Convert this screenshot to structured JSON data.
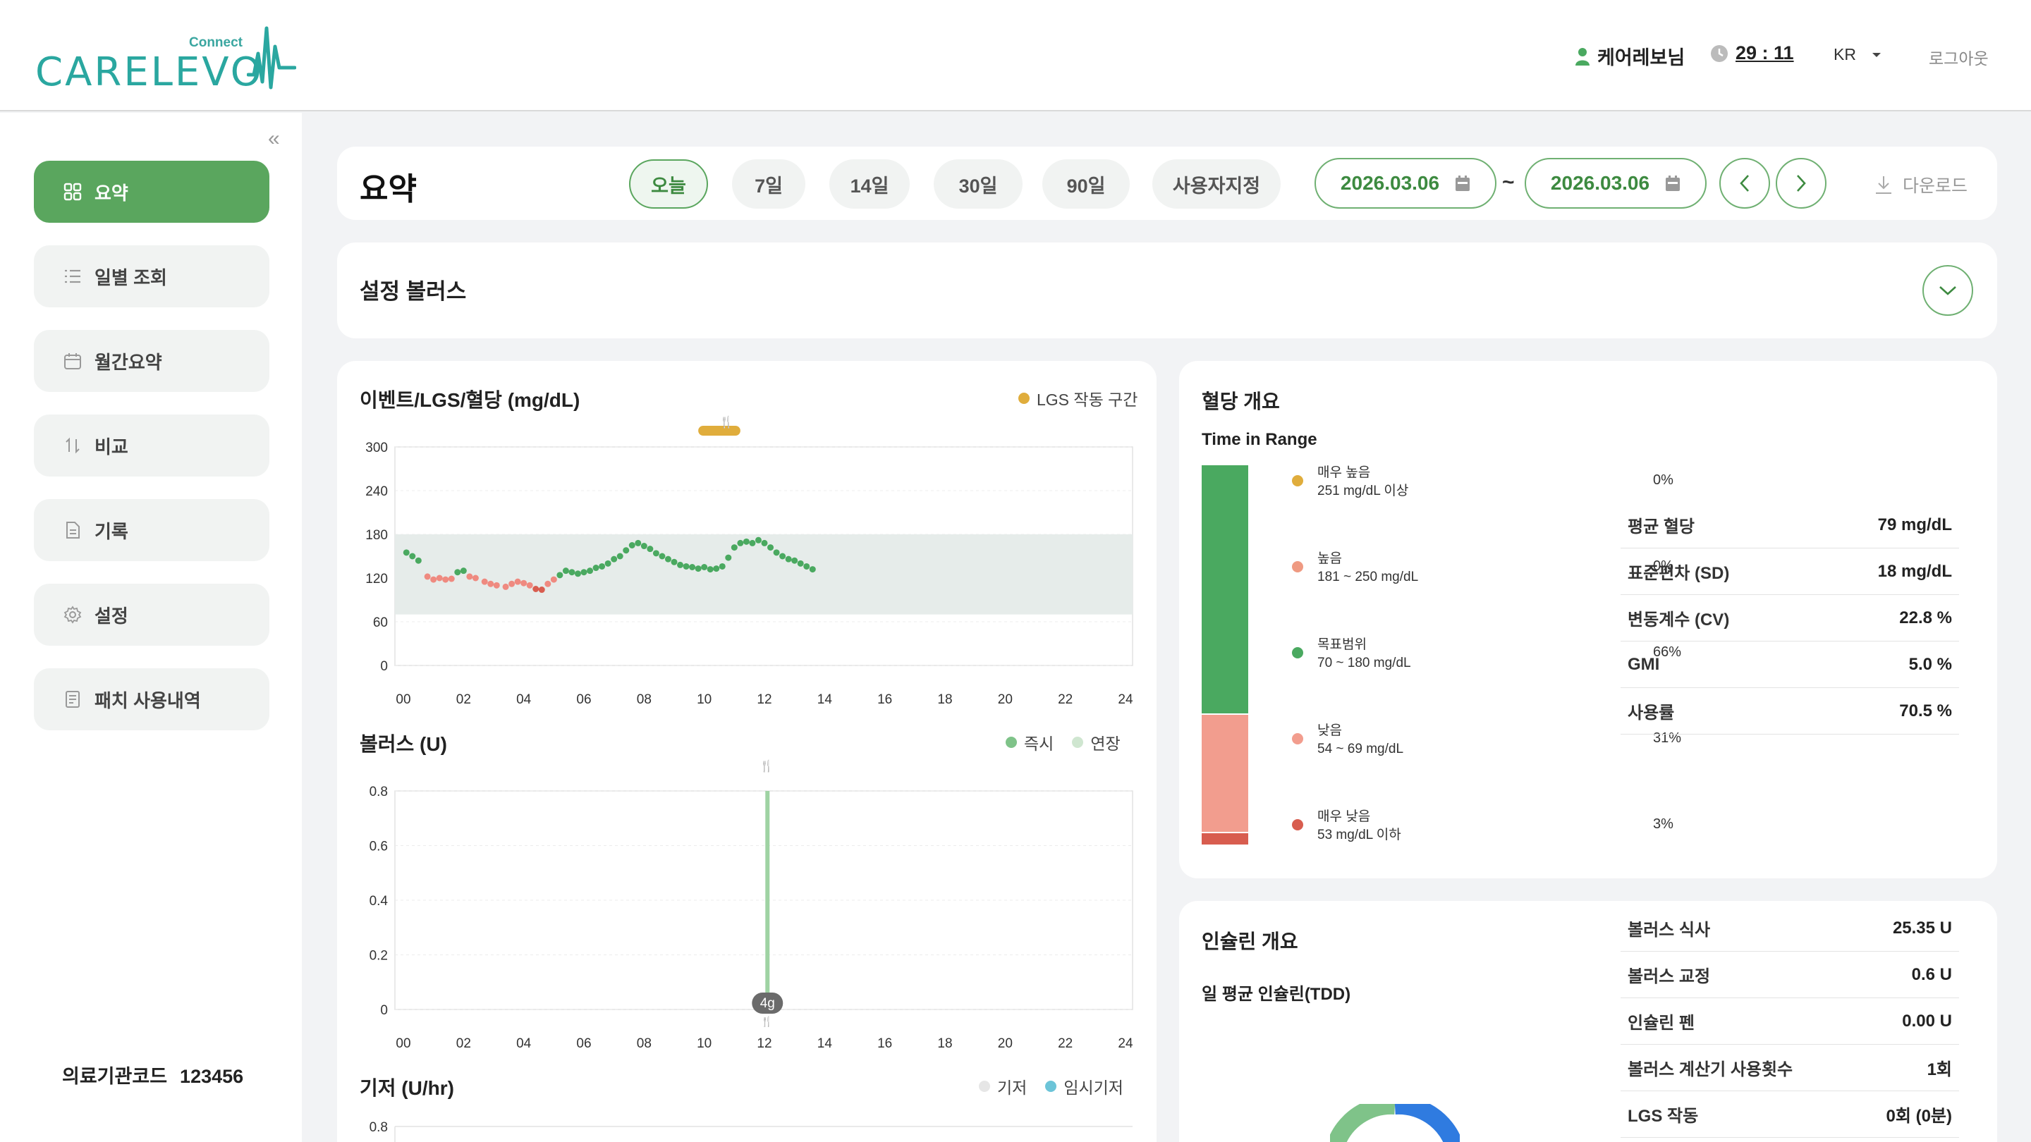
{
  "header": {
    "logo_connect": "Connect",
    "logo_word": "CARELEVO",
    "user_name": "케어레보님",
    "timer": "29 : 11",
    "lang": "KR",
    "logout": "로그아웃"
  },
  "sidebar": {
    "items": [
      {
        "label": "요약",
        "icon": "grid-icon"
      },
      {
        "label": "일별 조회",
        "icon": "list-icon"
      },
      {
        "label": "월간요약",
        "icon": "calendar-icon"
      },
      {
        "label": "비교",
        "icon": "sort-icon"
      },
      {
        "label": "기록",
        "icon": "document-icon"
      },
      {
        "label": "설정",
        "icon": "gear-icon"
      },
      {
        "label": "패치 사용내역",
        "icon": "receipt-icon"
      }
    ],
    "org_code_label": "의료기관코드",
    "org_code": "123456"
  },
  "toolbar": {
    "title": "요약",
    "ranges": [
      "오늘",
      "7일",
      "14일",
      "30일",
      "90일",
      "사용자지정"
    ],
    "active_range": "오늘",
    "start_date": "2026.03.06",
    "end_date": "2026.03.06",
    "tilde": "~",
    "download": "다운로드"
  },
  "bolus_settings": {
    "title": "설정 볼러스"
  },
  "charts": {
    "glucose_title": "이벤트/LGS/혈당 (mg/dL)",
    "lgs_legend": "LGS 작동 구간",
    "bolus_title": "볼러스 (U)",
    "bolus_legend_immediate": "즉시",
    "bolus_legend_extended": "연장",
    "basal_title": "기저 (U/hr)",
    "basal_legend_basal": "기저",
    "basal_legend_temp": "임시기저",
    "meal_badge": "4g"
  },
  "chart_data": [
    {
      "type": "scatter",
      "title": "이벤트/LGS/혈당 (mg/dL)",
      "x_ticks": [
        "00",
        "02",
        "04",
        "06",
        "08",
        "10",
        "12",
        "14",
        "16",
        "18",
        "20",
        "22",
        "24"
      ],
      "y_ticks": [
        "300",
        "240",
        "180",
        "120",
        "60",
        "0"
      ],
      "ylim": [
        0,
        300
      ],
      "xlim": [
        0,
        24
      ],
      "target_range": [
        70,
        180
      ],
      "lgs_interval": [
        9.8,
        11.2
      ],
      "series": [
        {
          "name": "혈당",
          "points": [
            [
              0.1,
              155
            ],
            [
              0.3,
              150
            ],
            [
              0.5,
              144
            ],
            [
              0.8,
              122
            ],
            [
              1.0,
              118
            ],
            [
              1.2,
              120
            ],
            [
              1.4,
              118
            ],
            [
              1.6,
              119
            ],
            [
              1.8,
              128
            ],
            [
              2.0,
              130
            ],
            [
              2.2,
              122
            ],
            [
              2.4,
              120
            ],
            [
              2.7,
              115
            ],
            [
              2.9,
              112
            ],
            [
              3.1,
              110
            ],
            [
              3.4,
              108
            ],
            [
              3.6,
              112
            ],
            [
              3.8,
              115
            ],
            [
              4.0,
              113
            ],
            [
              4.2,
              110
            ],
            [
              4.4,
              105
            ],
            [
              4.6,
              104
            ],
            [
              4.8,
              112
            ],
            [
              5.0,
              118
            ],
            [
              5.2,
              124
            ],
            [
              5.4,
              130
            ],
            [
              5.6,
              128
            ],
            [
              5.8,
              126
            ],
            [
              6.0,
              128
            ],
            [
              6.2,
              130
            ],
            [
              6.4,
              134
            ],
            [
              6.6,
              136
            ],
            [
              6.8,
              140
            ],
            [
              7.0,
              146
            ],
            [
              7.2,
              150
            ],
            [
              7.4,
              158
            ],
            [
              7.6,
              165
            ],
            [
              7.8,
              168
            ],
            [
              8.0,
              164
            ],
            [
              8.2,
              160
            ],
            [
              8.4,
              154
            ],
            [
              8.6,
              150
            ],
            [
              8.8,
              146
            ],
            [
              9.0,
              142
            ],
            [
              9.2,
              138
            ],
            [
              9.4,
              136
            ],
            [
              9.6,
              135
            ],
            [
              9.8,
              133
            ],
            [
              10.0,
              135
            ],
            [
              10.2,
              132
            ],
            [
              10.4,
              133
            ],
            [
              10.6,
              136
            ],
            [
              10.8,
              148
            ],
            [
              11.0,
              162
            ],
            [
              11.2,
              168
            ],
            [
              11.4,
              170
            ],
            [
              11.6,
              168
            ],
            [
              11.8,
              172
            ],
            [
              12.0,
              168
            ],
            [
              12.2,
              162
            ],
            [
              12.4,
              155
            ],
            [
              12.6,
              150
            ],
            [
              12.8,
              146
            ],
            [
              13.0,
              144
            ],
            [
              13.2,
              140
            ],
            [
              13.4,
              136
            ],
            [
              13.6,
              132
            ]
          ]
        }
      ]
    },
    {
      "type": "bar",
      "title": "볼러스 (U)",
      "x_ticks": [
        "00",
        "02",
        "04",
        "06",
        "08",
        "10",
        "12",
        "14",
        "16",
        "18",
        "20",
        "22",
        "24"
      ],
      "y_ticks": [
        "0.8",
        "0.6",
        "0.4",
        "0.2",
        "0"
      ],
      "ylim": [
        0,
        0.8
      ],
      "xlim": [
        0,
        24
      ],
      "series": [
        {
          "name": "즉시",
          "points": [
            [
              12.1,
              0.8
            ]
          ]
        }
      ]
    },
    {
      "type": "line",
      "title": "기저 (U/hr)",
      "y_ticks": [
        "0.8"
      ],
      "ylim": [
        0,
        0.8
      ]
    }
  ],
  "glucose_overview": {
    "title": "혈당 개요",
    "tir_title": "Time in Range",
    "bands": [
      {
        "name": "매우 높음",
        "range": "251 mg/dL 이상",
        "pct": "0%",
        "value": 0,
        "color": "#e0ad3c"
      },
      {
        "name": "높음",
        "range": "181 ~ 250 mg/dL",
        "pct": "0%",
        "value": 0,
        "color": "#ef9a82"
      },
      {
        "name": "목표범위",
        "range": "70 ~ 180 mg/dL",
        "pct": "66%",
        "value": 66,
        "color": "#4aa960"
      },
      {
        "name": "낮음",
        "range": "54 ~ 69 mg/dL",
        "pct": "31%",
        "value": 31,
        "color": "#f29d8e"
      },
      {
        "name": "매우 낮음",
        "range": "53 mg/dL 이하",
        "pct": "3%",
        "value": 3,
        "color": "#d85d4f"
      }
    ],
    "stats": [
      {
        "label": "평균 혈당",
        "value": "79 mg/dL"
      },
      {
        "label": "표준편차 (SD)",
        "value": "18 mg/dL"
      },
      {
        "label": "변동계수 (CV)",
        "value": "22.8 %"
      },
      {
        "label": "GMI",
        "value": "5.0 %"
      },
      {
        "label": "사용률",
        "value": "70.5 %"
      }
    ]
  },
  "insulin_overview": {
    "title": "인슐린 개요",
    "tdd_title": "일 평균 인슐린(TDD)",
    "stats": [
      {
        "label": "볼러스 식사",
        "value": "25.35 U"
      },
      {
        "label": "볼러스 교정",
        "value": "0.6 U"
      },
      {
        "label": "인슐린 펜",
        "value": "0.00 U"
      },
      {
        "label": "볼러스 계산기 사용횟수",
        "value": "1회"
      },
      {
        "label": "LGS 작동",
        "value": "0회 (0분)"
      }
    ]
  },
  "colors": {
    "accent": "#5aa65e",
    "target_band": "#e6ecea",
    "glucose_in_range": "#4aa960",
    "glucose_low": "#ef8a80",
    "glucose_very_low": "#d85d4f",
    "lgs": "#e0ad3c",
    "bolus_immediate": "#9fd3a3",
    "bolus_extended": "#cfe6d0",
    "basal": "#e0e0e0",
    "temp_basal": "#6cc4d8"
  }
}
